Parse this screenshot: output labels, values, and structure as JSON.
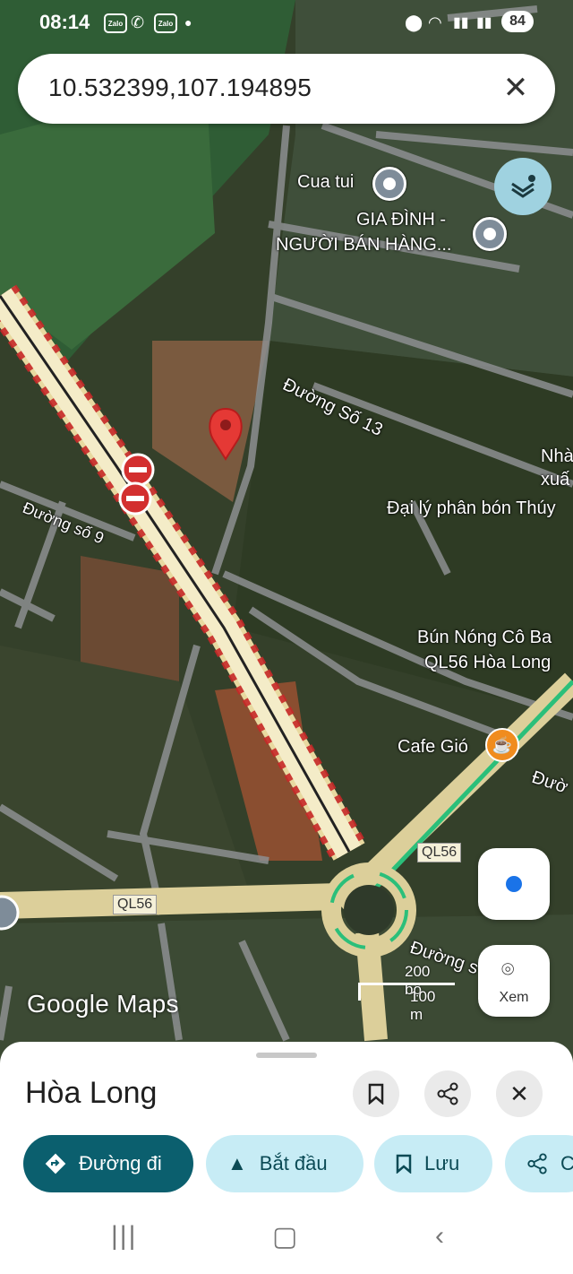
{
  "status_bar": {
    "time": "08:14",
    "notifications": [
      "Zalo",
      "Zalo"
    ],
    "battery": "84"
  },
  "search": {
    "query": "10.532399,107.194895"
  },
  "map": {
    "labels": {
      "cua_tui": "Cua tui",
      "gia_dinh_1": "GIA ĐÌNH -",
      "gia_dinh_2": "NGƯỜI BÁN HÀNG...",
      "duong_so_13": "Đường Số 13",
      "nha_1": "Nhà",
      "nha_2": "xuấ",
      "dai_ly": "Đại lý phân bón Thúy",
      "duong_so_9": "Đường số 9",
      "bun_nong_1": "Bún Nóng Cô Ba",
      "bun_nong_2": "QL56 Hòa Long",
      "cafe_gio": "Cafe Gió",
      "duong_right": "Đườ",
      "ql56_a": "QL56",
      "ql56_b": "QL56",
      "duong_s": "Đường s"
    },
    "scale": {
      "feet": "200 bộ",
      "meters": "100 m"
    },
    "attribution": "Google Maps",
    "view_button": "Xem",
    "accent_color": "#1a73e8",
    "pin_color": "#e53935"
  },
  "place_sheet": {
    "name": "Hòa Long",
    "actions": {
      "directions": "Đường đi",
      "start": "Bắt đầu",
      "save": "Lưu",
      "share": "C"
    }
  },
  "colors": {
    "primary_chip": "#0b5f6e",
    "secondary_chip": "#c7ecf5"
  }
}
